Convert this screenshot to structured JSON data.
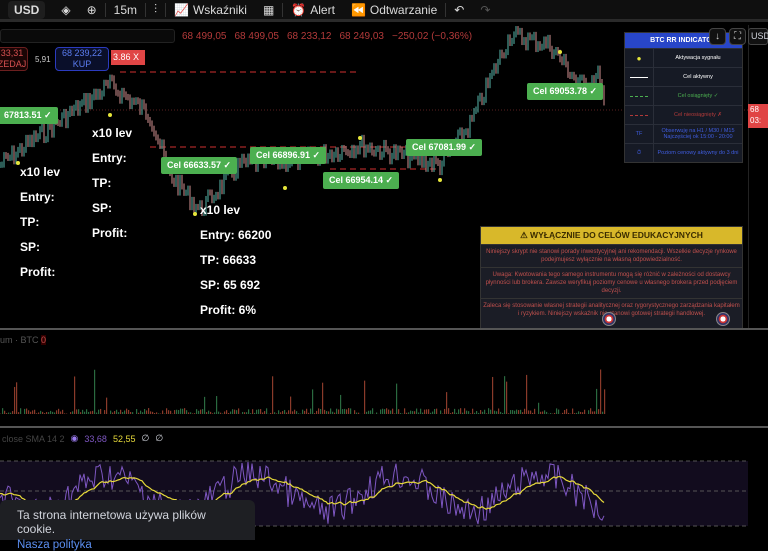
{
  "toolbar": {
    "symbol": "USD",
    "interval": "15m",
    "indicators": "Wskaźniki",
    "alert": "Alert",
    "replay": "Odtwarzanie"
  },
  "legend": {
    "ohlc": [
      "68 499,05",
      "68 499,05",
      "68 233,12",
      "68 249,03",
      "−250,02 (−0,36%)"
    ]
  },
  "trade": {
    "sell_price": "33,31",
    "sell_label": "ZEDAJ",
    "spread": "5,91",
    "buy_price": "68 239,22",
    "buy_label": "KUP",
    "red_tag": "3.86 X"
  },
  "targets": [
    "67813.51 ✓",
    "Cel 66633.57 ✓",
    "Cel 66896.91 ✓",
    "Cel 66954.14 ✓",
    "Cel 67081.99 ✓",
    "Cel 69053.78 ✓"
  ],
  "trade_blocks": [
    {
      "lev": "x10 lev",
      "entry": "Entry:",
      "tp": "TP:",
      "sp": "SP:",
      "profit": "Profit:"
    },
    {
      "lev": "x10 lev",
      "entry": "Entry:",
      "tp": "TP:",
      "sp": "SP:",
      "profit": "Profit:"
    },
    {
      "lev": "x10 lev",
      "entry": "Entry: 66200",
      "tp": "TP: 66633",
      "sp": "SP: 65 692",
      "profit": "Profit: 6%"
    }
  ],
  "rr_panel": {
    "title": "BTC RR INDICATOR",
    "rows": [
      {
        "label": "Aktywacja sygnału",
        "color": "#ffffff"
      },
      {
        "label": "Cel aktywny",
        "color": "#ffffff"
      },
      {
        "label": "Cel osiągnięty ✓",
        "color": "#4caf50"
      },
      {
        "label": "Cel nieosiągnięty ✗",
        "color": "#b23a3a"
      },
      {
        "label": "Obserwuję na H1 / M30 / M15 Najczęściej ok 15:00 - 20:00",
        "color": "#3f5de0",
        "icon": "TF"
      },
      {
        "label": "Poziom cenowy aktywny do 3 dni",
        "color": "#3f5de0",
        "icon": "⏱"
      }
    ]
  },
  "edu": {
    "title": "⚠ WYŁĄCZNIE DO CELÓW EDUKACYJNYCH",
    "sections": [
      "Niniejszy skrypt nie stanowi porady inwestycyjnej ani rekomendacji. Wszelkie decyzje rynkowe podejmujesz wyłącznie na własną odpowiedzialność.",
      "Uwaga: Kwotowania tego samego instrumentu mogą się różnić w zależności od dostawcy płynności lub brokera. Zawsze weryfikuj poziomy cenowe u własnego brokera przed podjęciem decyzji.",
      "Zaleca się stosowanie własnej strategii analitycznej oraz rygorystycznego zarządzania kapitałem i ryzykiem. Niniejszy wskaźnik nie stanowi gotowej strategii handlowej."
    ]
  },
  "axis": {
    "usd": "USD",
    "price_tag": [
      "68",
      "03:"
    ]
  },
  "volume": {
    "label": "um · BTC",
    "value": "0"
  },
  "rsi": {
    "label": "close SMA 14 2",
    "v1": "33,68",
    "v2": "52,55",
    "v3": "∅",
    "v4": "∅"
  },
  "cookie": {
    "text": "Ta strona internetowa używa plików cookie.",
    "link": "Nasza polityka"
  },
  "colors": {
    "up": "#26a69a",
    "down": "#ef5350",
    "target": "#4caf50",
    "rsi": "#7e57c2",
    "rsi_ma": "#e6d93a"
  }
}
